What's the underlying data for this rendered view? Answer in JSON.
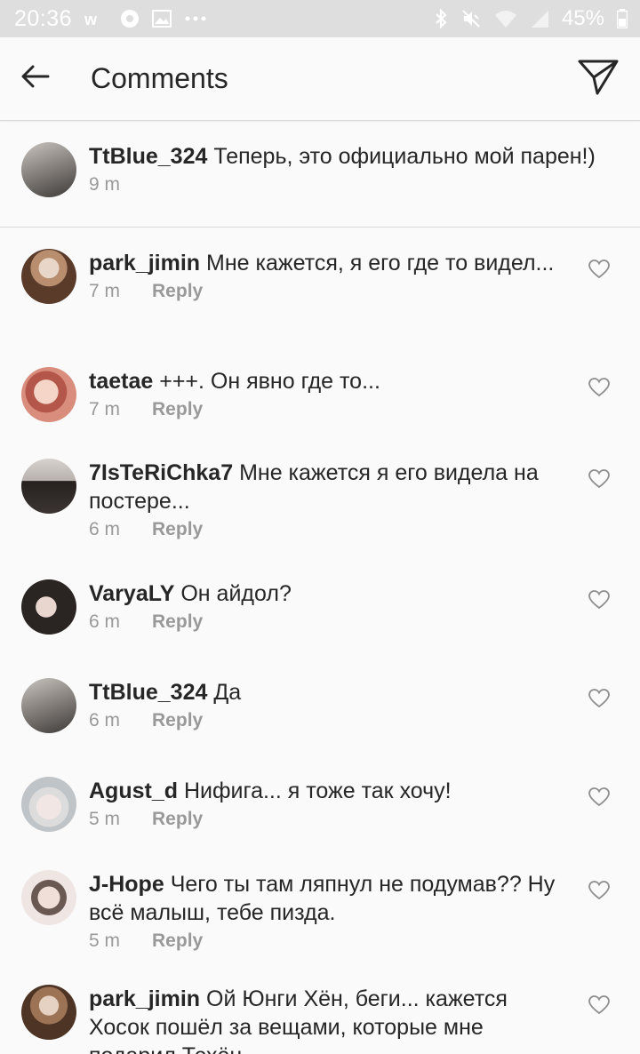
{
  "status_bar": {
    "time": "20:36",
    "battery_percent": "45%",
    "left_icons": [
      "vk-icon",
      "chrome-icon",
      "gallery-icon",
      "more-dots-icon"
    ],
    "right_icons": [
      "bluetooth-icon",
      "mute-icon",
      "wifi-icon",
      "signal-icon",
      "battery-icon"
    ]
  },
  "header": {
    "title": "Comments",
    "back_icon": "arrow-left-icon",
    "send_icon": "send-icon"
  },
  "caption": {
    "username": "TtBlue_324",
    "text": "Теперь, это официально мой парен!)",
    "time": "9 m"
  },
  "reply_label": "Reply",
  "comments": [
    {
      "username": "park_jimin",
      "text": "Мне кажется, я его где то видел...",
      "time": "7 m"
    },
    {
      "username": "taetae",
      "text": "+++. Он явно где то...",
      "time": "7 m"
    },
    {
      "username": "7IsTeRiChka7",
      "text": "Мне кажется я его видела на постере...",
      "time": "6 m"
    },
    {
      "username": "VaryaLY",
      "text": "Он айдол?",
      "time": "6 m"
    },
    {
      "username": "TtBlue_324",
      "text": "Да",
      "time": "6 m"
    },
    {
      "username": "Agust_d",
      "text": "Нифига... я тоже так хочу!",
      "time": "5 m"
    },
    {
      "username": "J-Hope",
      "text": "Чего ты там ляпнул не подумав?? Ну всё малыш, тебе пизда.",
      "time": "5 m"
    },
    {
      "username": "park_jimin",
      "text": "Ой Юнги Хён, беги... кажется Хосок пошёл за вещами, которые мне подарил Техён",
      "time": ""
    }
  ],
  "colors": {
    "text": "#262626",
    "meta": "#999999",
    "divider": "#d9d9d9",
    "background": "#fafafa",
    "status_bar": "#dedede"
  }
}
